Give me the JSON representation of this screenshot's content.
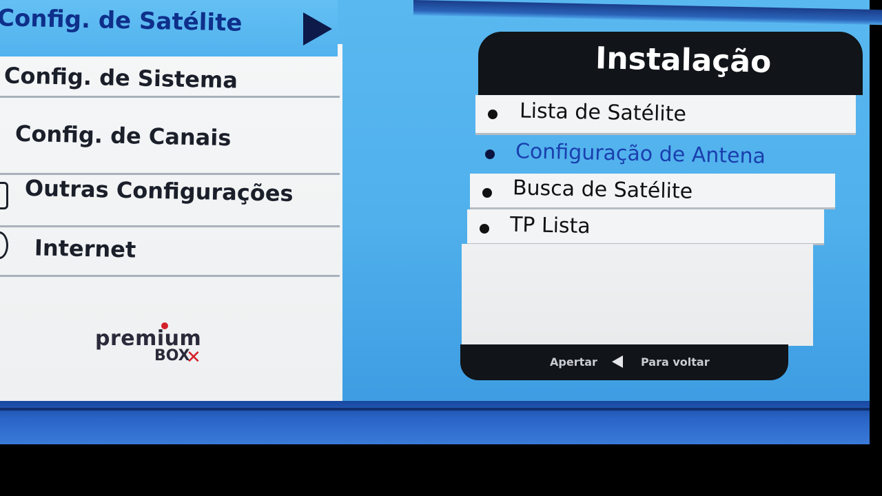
{
  "left_menu": {
    "selected_item": "Config. de Satélite",
    "items": [
      {
        "label": "Config. de Sistema"
      },
      {
        "label": "Config. de Canais"
      },
      {
        "label": "Outras Configurações"
      },
      {
        "label": "Internet"
      }
    ]
  },
  "logo": {
    "line1": "premium",
    "line2": "BOX"
  },
  "panel": {
    "title": "Instalação",
    "items": [
      {
        "label": "Lista de Satélite"
      },
      {
        "label": "Configuração de Antena"
      },
      {
        "label": "Busca de Satélite"
      },
      {
        "label": "TP Lista"
      }
    ],
    "selected_index": 1,
    "footer": {
      "press_label": "Apertar",
      "back_label": "Para voltar"
    }
  },
  "colors": {
    "background_blue": "#4fb0ec",
    "selected_text_blue": "#1a3fae",
    "panel_dark": "#111418",
    "logo_red": "#d4202a"
  },
  "icons": {
    "menu_arrow": "right-triangle-icon",
    "back": "left-triangle-icon",
    "bullet": "bullet-dot-icon"
  }
}
